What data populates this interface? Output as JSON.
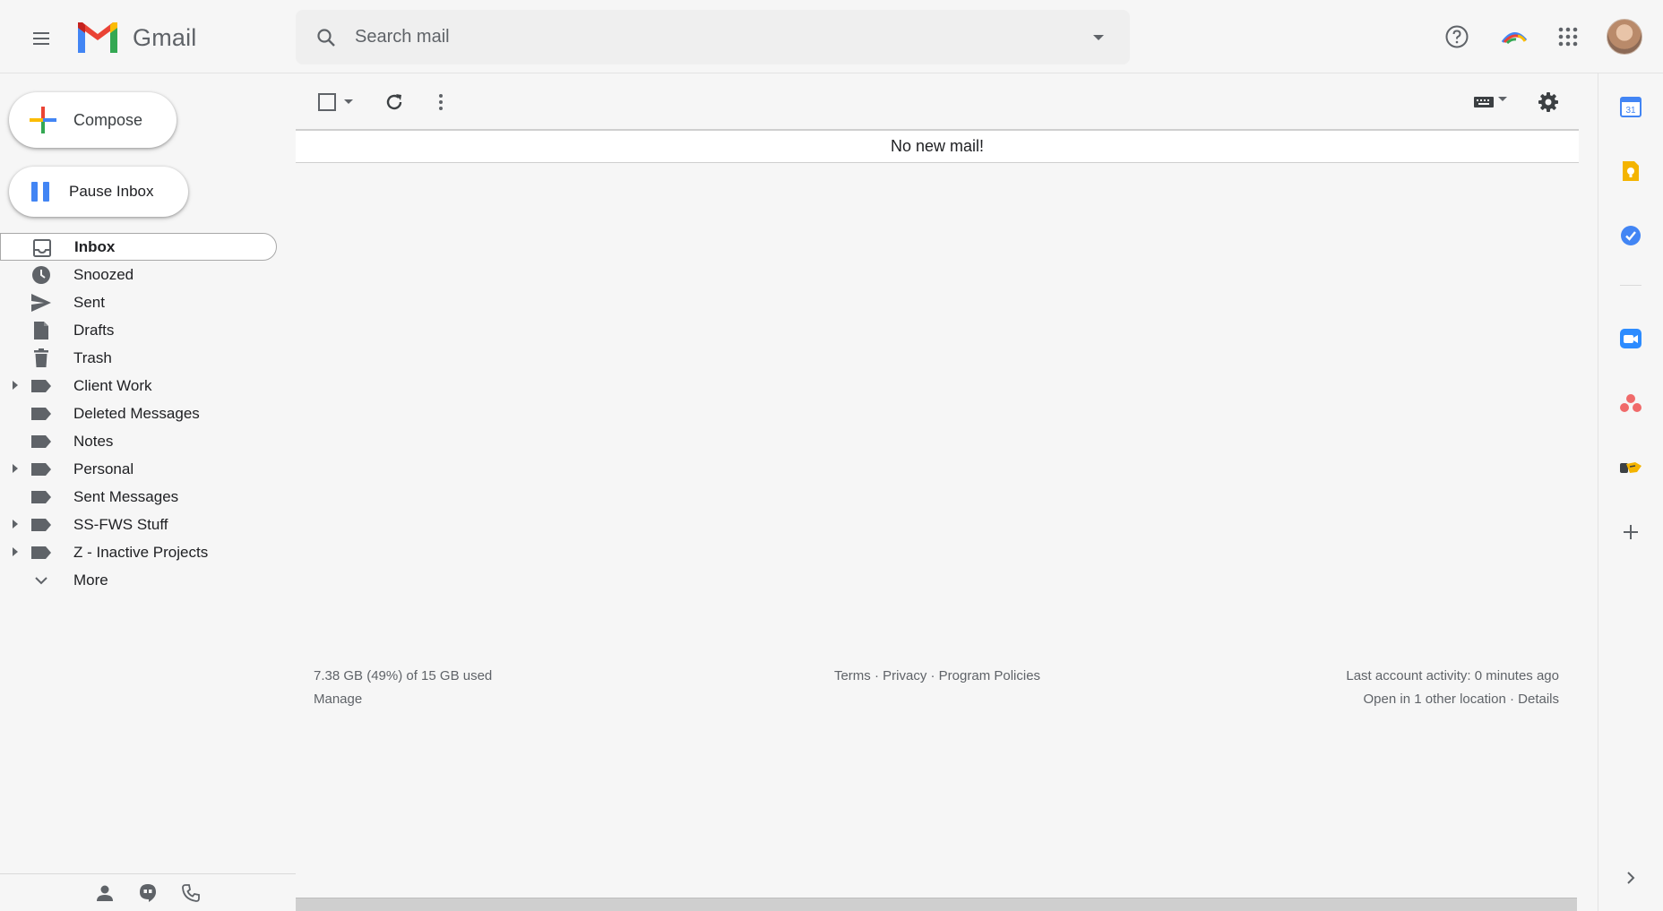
{
  "header": {
    "app_name": "Gmail",
    "search_placeholder": "Search mail"
  },
  "sidebar": {
    "compose_label": "Compose",
    "pause_label": "Pause Inbox",
    "items": [
      {
        "label": "Inbox",
        "icon": "inbox-icon",
        "active": true,
        "expandable": false
      },
      {
        "label": "Snoozed",
        "icon": "clock-icon",
        "active": false,
        "expandable": false
      },
      {
        "label": "Sent",
        "icon": "send-icon",
        "active": false,
        "expandable": false
      },
      {
        "label": "Drafts",
        "icon": "draft-icon",
        "active": false,
        "expandable": false
      },
      {
        "label": "Trash",
        "icon": "trash-icon",
        "active": false,
        "expandable": false
      },
      {
        "label": "Client Work",
        "icon": "label-icon",
        "active": false,
        "expandable": true
      },
      {
        "label": "Deleted Messages",
        "icon": "label-icon",
        "active": false,
        "expandable": false
      },
      {
        "label": "Notes",
        "icon": "label-icon",
        "active": false,
        "expandable": false
      },
      {
        "label": "Personal",
        "icon": "label-icon",
        "active": false,
        "expandable": true
      },
      {
        "label": "Sent Messages",
        "icon": "label-icon",
        "active": false,
        "expandable": false
      },
      {
        "label": "SS-FWS Stuff",
        "icon": "label-icon",
        "active": false,
        "expandable": true
      },
      {
        "label": "Z - Inactive Projects",
        "icon": "label-icon",
        "active": false,
        "expandable": true
      },
      {
        "label": "More",
        "icon": "chevron-down-icon",
        "active": false,
        "expandable": false
      }
    ]
  },
  "main": {
    "empty_message": "No new mail!"
  },
  "footer": {
    "storage": "7.38 GB (49%) of 15 GB used",
    "manage": "Manage",
    "terms": "Terms",
    "privacy": "Privacy",
    "program_policies": "Program Policies",
    "separator": " · ",
    "last_activity": "Last account activity: 0 minutes ago",
    "open_location": "Open in 1 other location",
    "details": "Details"
  },
  "side_panel": {
    "calendar_day": "31"
  },
  "colors": {
    "accent_blue": "#4285f4",
    "gmail_red": "#ea4335",
    "keep_yellow": "#f4b400",
    "zoom_blue": "#2d8cff",
    "asana_coral": "#f06a6a"
  }
}
